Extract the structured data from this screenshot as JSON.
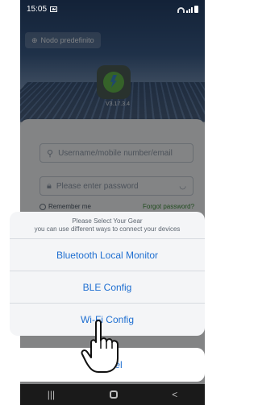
{
  "status_bar": {
    "time": "15:05"
  },
  "header": {
    "node_label": "Nodo predefinito",
    "version": "V3.17.3.4"
  },
  "login": {
    "username_placeholder": "Username/mobile number/email",
    "password_placeholder": "Please enter password",
    "remember_label": "Remember me",
    "forgot_label": "Forgot password?"
  },
  "sheet": {
    "title": "Please Select Your Gear",
    "subtitle": "you can use different ways to connect your devices",
    "options": [
      "Bluetooth Local Monitor",
      "BLE Config",
      "Wi-Fi Config"
    ],
    "cancel": "Cancel"
  },
  "nav": {
    "recent": "|||",
    "back": "<"
  },
  "colors": {
    "accent": "#1f6fd1",
    "brand_green": "#3e8b3a"
  }
}
